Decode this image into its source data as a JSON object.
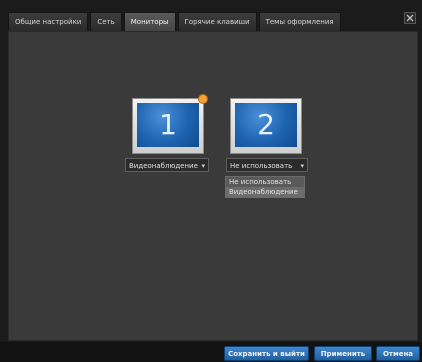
{
  "tabs": [
    {
      "label": "Общие настройки"
    },
    {
      "label": "Сеть"
    },
    {
      "label": "Мониторы"
    },
    {
      "label": "Горячие клавиши"
    },
    {
      "label": "Темы оформления"
    }
  ],
  "active_tab": "Мониторы",
  "monitors": [
    {
      "number": "1",
      "selection": "Видеонаблюдение"
    },
    {
      "number": "2",
      "selection": "Не использовать"
    }
  ],
  "dropdown": {
    "options": [
      "Не использовать",
      "Видеонаблюдение"
    ],
    "selected": "Не использовать",
    "hovered": "Видеонаблюдение"
  },
  "footer": {
    "save_exit_label": "Сохранить и выйти",
    "apply_label": "Применить",
    "cancel_label": "Отмена"
  },
  "colors": {
    "accent": "#2f79c4",
    "badge": "#f1a33a"
  }
}
